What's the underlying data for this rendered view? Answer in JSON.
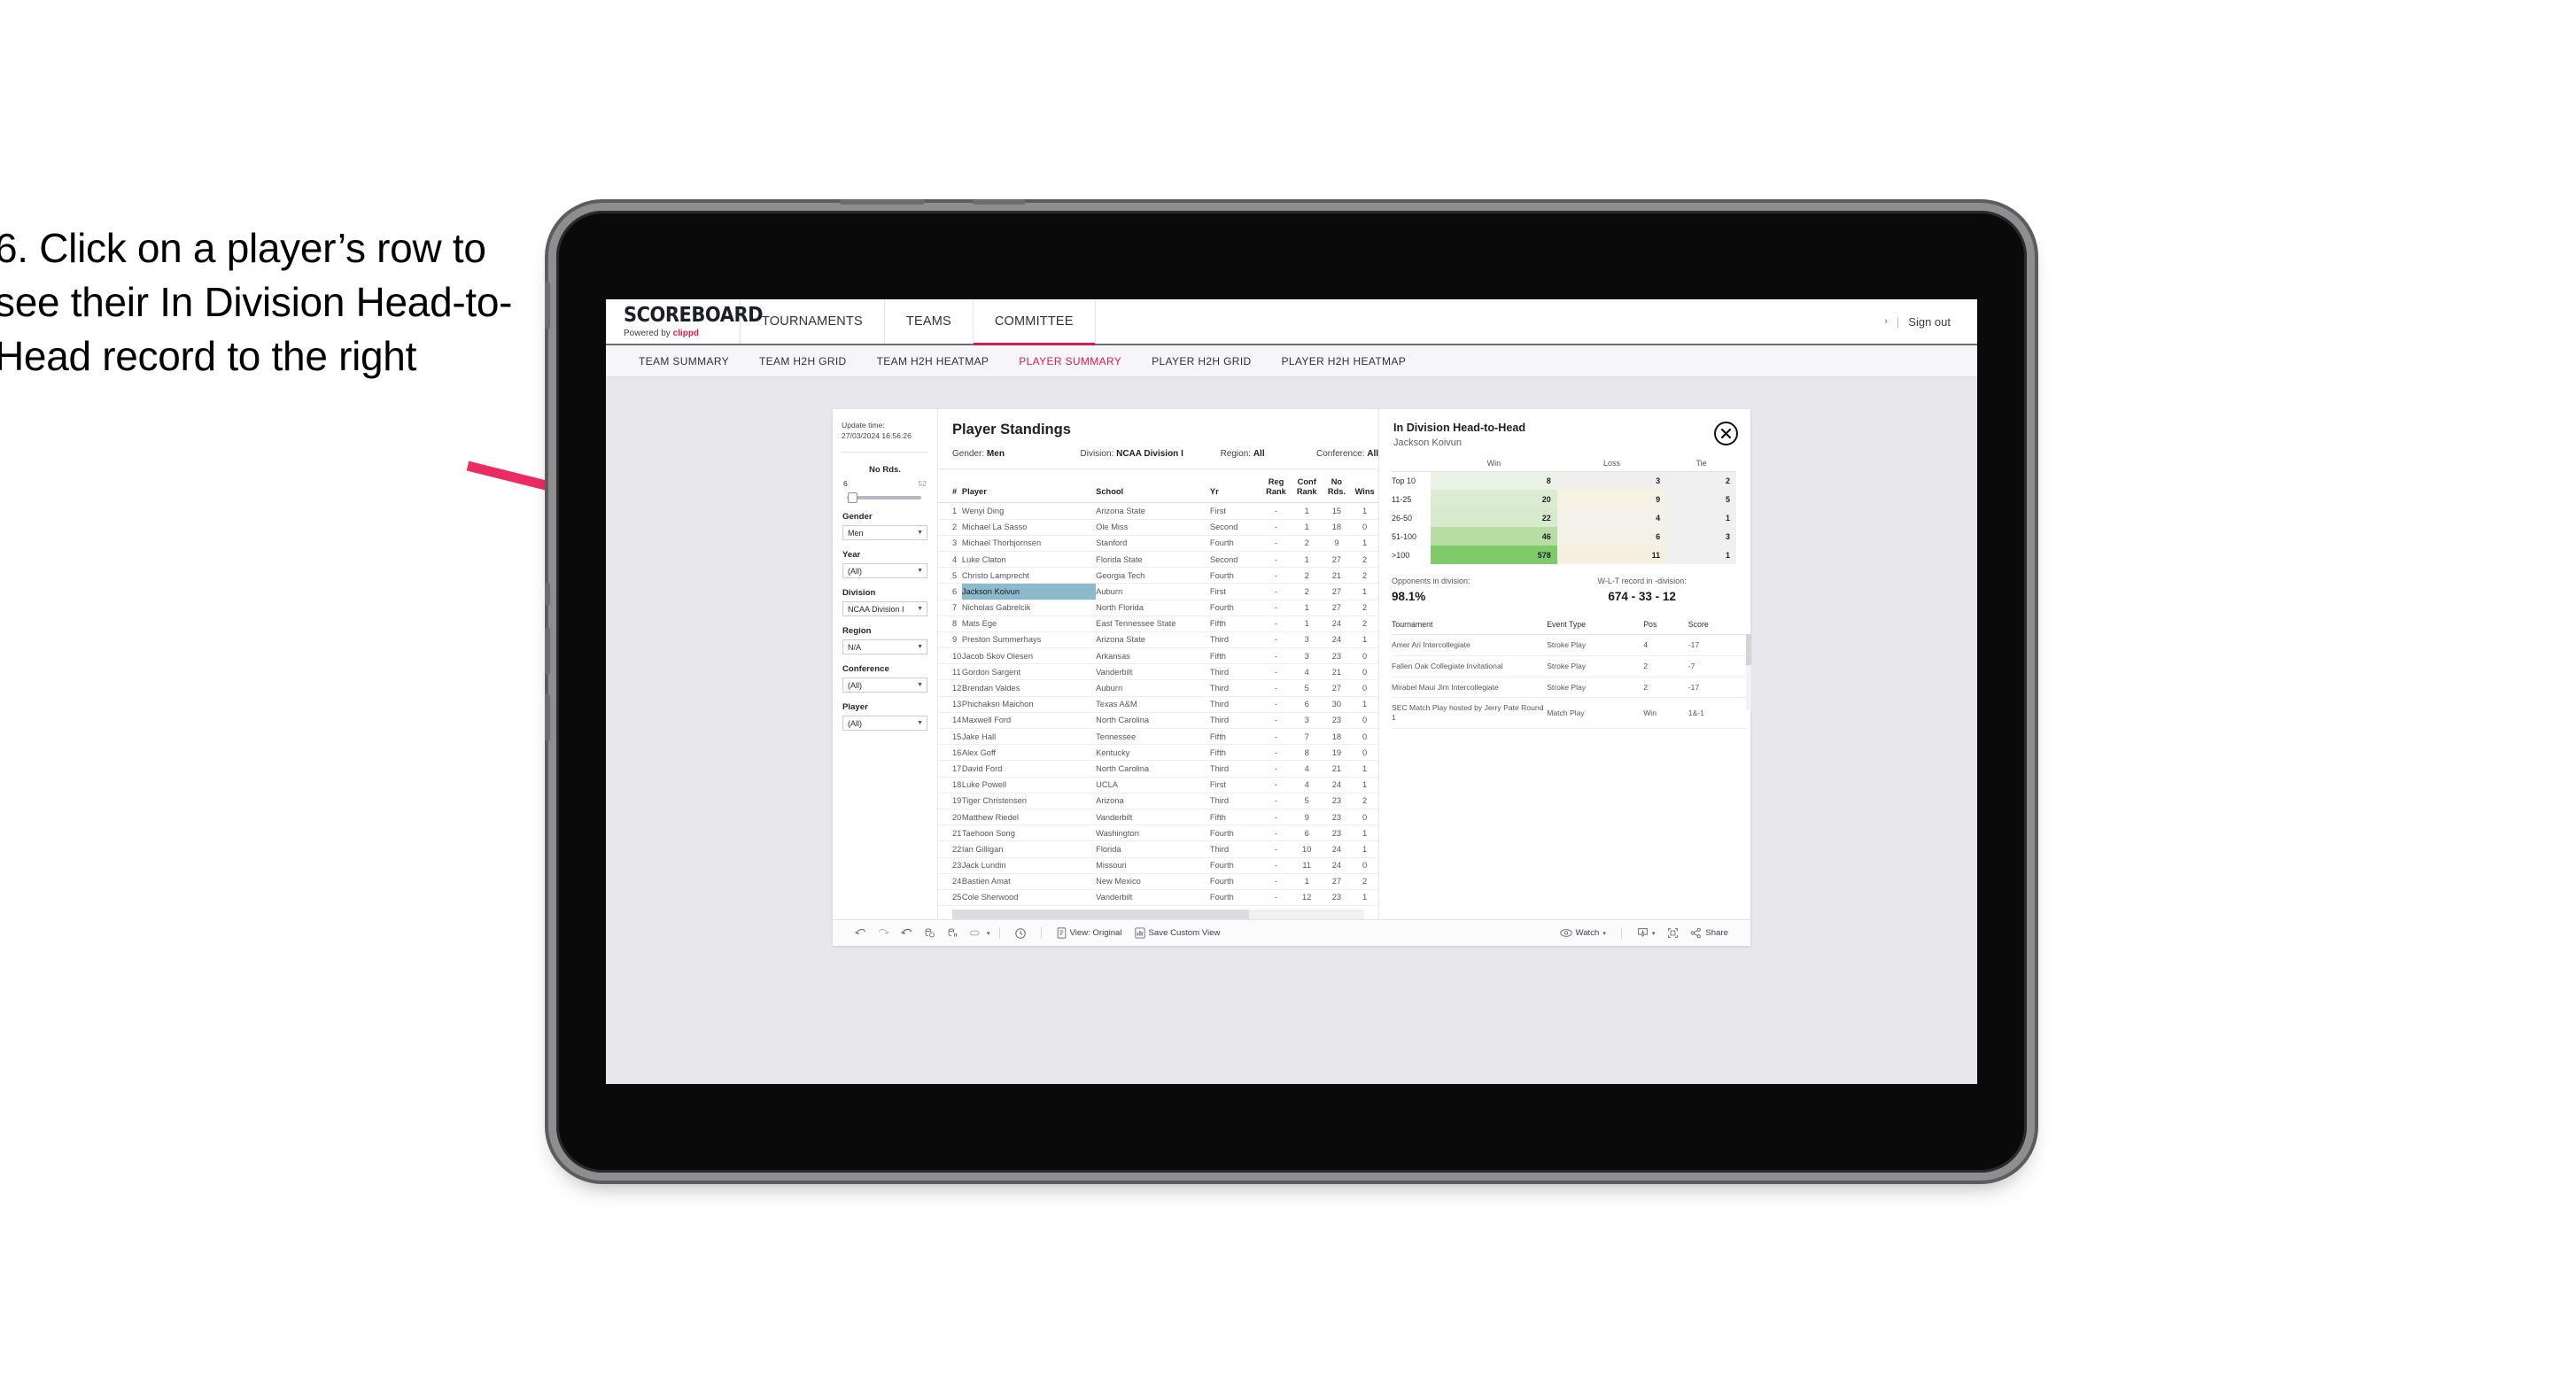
{
  "annotation": {
    "text": "6. Click on a player’s row to see their In Division Head-to-Head record to the right",
    "arrow_color": "#ec2b62"
  },
  "header": {
    "brand_title": "SCOREBOARD",
    "brand_powered_prefix": "Powered by ",
    "brand_powered_name": "clippd",
    "nav": [
      {
        "label": "TOURNAMENTS",
        "active": false
      },
      {
        "label": "TEAMS",
        "active": false
      },
      {
        "label": "COMMITTEE",
        "active": true
      }
    ],
    "caret": "›",
    "separator": "|",
    "sign_out": "Sign out"
  },
  "sub_nav": [
    {
      "label": "TEAM SUMMARY",
      "active": false
    },
    {
      "label": "TEAM H2H GRID",
      "active": false
    },
    {
      "label": "TEAM H2H HEATMAP",
      "active": false
    },
    {
      "label": "PLAYER SUMMARY",
      "active": true
    },
    {
      "label": "PLAYER H2H GRID",
      "active": false
    },
    {
      "label": "PLAYER H2H HEATMAP",
      "active": false
    }
  ],
  "filters": {
    "update_label": "Update time:",
    "update_value": "27/03/2024 16:56:26",
    "slider": {
      "title": "No Rds.",
      "min": "6",
      "max": "52"
    },
    "groups": [
      {
        "label": "Gender",
        "value": "Men"
      },
      {
        "label": "Year",
        "value": "(All)"
      },
      {
        "label": "Division",
        "value": "NCAA Division I"
      },
      {
        "label": "Region",
        "value": "N/A"
      },
      {
        "label": "Conference",
        "value": "(All)"
      },
      {
        "label": "Player",
        "value": "(All)"
      }
    ]
  },
  "standings": {
    "title": "Player Standings",
    "meta": [
      {
        "cap": "Gender: ",
        "val": "Men"
      },
      {
        "cap": "Division: ",
        "val": "NCAA Division I"
      },
      {
        "cap": "Region: ",
        "val": "All"
      },
      {
        "cap": "Conference: ",
        "val": "All"
      }
    ],
    "columns": [
      "#",
      "Player",
      "School",
      "Yr",
      "Reg Rank",
      "Conf Rank",
      "No Rds.",
      "Wins"
    ],
    "rows": [
      {
        "rank": "1",
        "player": "Wenyi Ding",
        "school": "Arizona State",
        "yr": "First",
        "reg": "-",
        "conf": "1",
        "rds": "15",
        "wins": "1",
        "selected": false
      },
      {
        "rank": "2",
        "player": "Michael La Sasso",
        "school": "Ole Miss",
        "yr": "Second",
        "reg": "-",
        "conf": "1",
        "rds": "18",
        "wins": "0",
        "selected": false
      },
      {
        "rank": "3",
        "player": "Michael Thorbjornsen",
        "school": "Stanford",
        "yr": "Fourth",
        "reg": "-",
        "conf": "2",
        "rds": "9",
        "wins": "1",
        "selected": false
      },
      {
        "rank": "4",
        "player": "Luke Claton",
        "school": "Florida State",
        "yr": "Second",
        "reg": "-",
        "conf": "1",
        "rds": "27",
        "wins": "2",
        "selected": false
      },
      {
        "rank": "5",
        "player": "Christo Lamprecht",
        "school": "Georgia Tech",
        "yr": "Fourth",
        "reg": "-",
        "conf": "2",
        "rds": "21",
        "wins": "2",
        "selected": false
      },
      {
        "rank": "6",
        "player": "Jackson Koivun",
        "school": "Auburn",
        "yr": "First",
        "reg": "-",
        "conf": "2",
        "rds": "27",
        "wins": "1",
        "selected": true
      },
      {
        "rank": "7",
        "player": "Nicholas Gabrelcik",
        "school": "North Florida",
        "yr": "Fourth",
        "reg": "-",
        "conf": "1",
        "rds": "27",
        "wins": "2",
        "selected": false
      },
      {
        "rank": "8",
        "player": "Mats Ege",
        "school": "East Tennessee State",
        "yr": "Fifth",
        "reg": "-",
        "conf": "1",
        "rds": "24",
        "wins": "2",
        "selected": false
      },
      {
        "rank": "9",
        "player": "Preston Summerhays",
        "school": "Arizona State",
        "yr": "Third",
        "reg": "-",
        "conf": "3",
        "rds": "24",
        "wins": "1",
        "selected": false
      },
      {
        "rank": "10",
        "player": "Jacob Skov Olesen",
        "school": "Arkansas",
        "yr": "Fifth",
        "reg": "-",
        "conf": "3",
        "rds": "23",
        "wins": "0",
        "selected": false
      },
      {
        "rank": "11",
        "player": "Gordon Sargent",
        "school": "Vanderbilt",
        "yr": "Third",
        "reg": "-",
        "conf": "4",
        "rds": "21",
        "wins": "0",
        "selected": false
      },
      {
        "rank": "12",
        "player": "Brendan Valdes",
        "school": "Auburn",
        "yr": "Third",
        "reg": "-",
        "conf": "5",
        "rds": "27",
        "wins": "0",
        "selected": false
      },
      {
        "rank": "13",
        "player": "Phichaksn Maichon",
        "school": "Texas A&M",
        "yr": "Third",
        "reg": "-",
        "conf": "6",
        "rds": "30",
        "wins": "1",
        "selected": false
      },
      {
        "rank": "14",
        "player": "Maxwell Ford",
        "school": "North Carolina",
        "yr": "Third",
        "reg": "-",
        "conf": "3",
        "rds": "23",
        "wins": "0",
        "selected": false
      },
      {
        "rank": "15",
        "player": "Jake Hall",
        "school": "Tennessee",
        "yr": "Fifth",
        "reg": "-",
        "conf": "7",
        "rds": "18",
        "wins": "0",
        "selected": false
      },
      {
        "rank": "16",
        "player": "Alex Goff",
        "school": "Kentucky",
        "yr": "Fifth",
        "reg": "-",
        "conf": "8",
        "rds": "19",
        "wins": "0",
        "selected": false
      },
      {
        "rank": "17",
        "player": "David Ford",
        "school": "North Carolina",
        "yr": "Third",
        "reg": "-",
        "conf": "4",
        "rds": "21",
        "wins": "1",
        "selected": false
      },
      {
        "rank": "18",
        "player": "Luke Powell",
        "school": "UCLA",
        "yr": "First",
        "reg": "-",
        "conf": "4",
        "rds": "24",
        "wins": "1",
        "selected": false
      },
      {
        "rank": "19",
        "player": "Tiger Christensen",
        "school": "Arizona",
        "yr": "Third",
        "reg": "-",
        "conf": "5",
        "rds": "23",
        "wins": "2",
        "selected": false
      },
      {
        "rank": "20",
        "player": "Matthew Riedel",
        "school": "Vanderbilt",
        "yr": "Fifth",
        "reg": "-",
        "conf": "9",
        "rds": "23",
        "wins": "0",
        "selected": false
      },
      {
        "rank": "21",
        "player": "Taehoon Song",
        "school": "Washington",
        "yr": "Fourth",
        "reg": "-",
        "conf": "6",
        "rds": "23",
        "wins": "1",
        "selected": false
      },
      {
        "rank": "22",
        "player": "Ian Gilligan",
        "school": "Florida",
        "yr": "Third",
        "reg": "-",
        "conf": "10",
        "rds": "24",
        "wins": "1",
        "selected": false
      },
      {
        "rank": "23",
        "player": "Jack Lundin",
        "school": "Missouri",
        "yr": "Fourth",
        "reg": "-",
        "conf": "11",
        "rds": "24",
        "wins": "0",
        "selected": false
      },
      {
        "rank": "24",
        "player": "Bastien Amat",
        "school": "New Mexico",
        "yr": "Fourth",
        "reg": "-",
        "conf": "1",
        "rds": "27",
        "wins": "2",
        "selected": false
      },
      {
        "rank": "25",
        "player": "Cole Sherwood",
        "school": "Vanderbilt",
        "yr": "Fourth",
        "reg": "-",
        "conf": "12",
        "rds": "23",
        "wins": "1",
        "selected": false
      }
    ]
  },
  "h2h": {
    "title": "In Division Head-to-Head",
    "subtitle": "Jackson Koivun",
    "close_icon": "close-icon",
    "heatmap": {
      "columns": [
        "Win",
        "Loss",
        "Tie"
      ],
      "rows": [
        {
          "label": "Top 10",
          "win": "8",
          "loss": "3",
          "tie": "2",
          "win_color": "#eaf3e6",
          "loss_color": "#f0efed",
          "tie_color": "#f0f0f0"
        },
        {
          "label": "11-25",
          "win": "20",
          "loss": "9",
          "tie": "5",
          "win_color": "#dcecd3",
          "loss_color": "#f5f2e4",
          "tie_color": "#f0f0f0"
        },
        {
          "label": "26-50",
          "win": "22",
          "loss": "4",
          "tie": "1",
          "win_color": "#d8eacd",
          "loss_color": "#f2f1ea",
          "tie_color": "#f0f0f0"
        },
        {
          "label": "51-100",
          "win": "46",
          "loss": "6",
          "tie": "3",
          "win_color": "#b7dda3",
          "loss_color": "#f3f1e8",
          "tie_color": "#f0f0f0"
        },
        {
          "label": ">100",
          "win": "578",
          "loss": "11",
          "tie": "1",
          "win_color": "#7fca6a",
          "loss_color": "#f4efdf",
          "tie_color": "#f0f0f0"
        }
      ]
    },
    "stats": [
      {
        "caption": "Opponents in division:",
        "value": "98.1%"
      },
      {
        "caption": "W-L-T record in -division:",
        "value": "674 - 33 - 12"
      }
    ],
    "tournaments": {
      "columns": [
        "Tournament",
        "Event Type",
        "Pos",
        "Score"
      ],
      "rows": [
        {
          "name": "Amer Ari Intercollegiate",
          "type": "Stroke Play",
          "pos": "4",
          "score": "-17"
        },
        {
          "name": "Fallen Oak Collegiate Invitational",
          "type": "Stroke Play",
          "pos": "2",
          "score": "-7"
        },
        {
          "name": "Mirabel Maui Jim Intercollegiate",
          "type": "Stroke Play",
          "pos": "2",
          "score": "-17"
        },
        {
          "name": "SEC Match Play hosted by Jerry Pate Round 1",
          "type": "Match Play",
          "pos": "Win",
          "score": "1&-1"
        }
      ]
    }
  },
  "toolbar": {
    "icons": [
      "undo-icon",
      "redo-icon",
      "revert-icon",
      "refresh-data-icon",
      "pause-updates-icon",
      "highlight-icon"
    ],
    "alerts_icon": "alerts-icon",
    "view_label": "View: Original",
    "view_icon": "view-original-icon",
    "save_label": "Save Custom View",
    "save_icon": "save-custom-view-icon",
    "watch_label": "Watch",
    "watch_icon": "eye-icon",
    "download_icon": "download-icon",
    "fullscreen_icon": "fullscreen-icon",
    "share_label": "Share",
    "share_icon": "share-icon",
    "caret": "▾"
  }
}
